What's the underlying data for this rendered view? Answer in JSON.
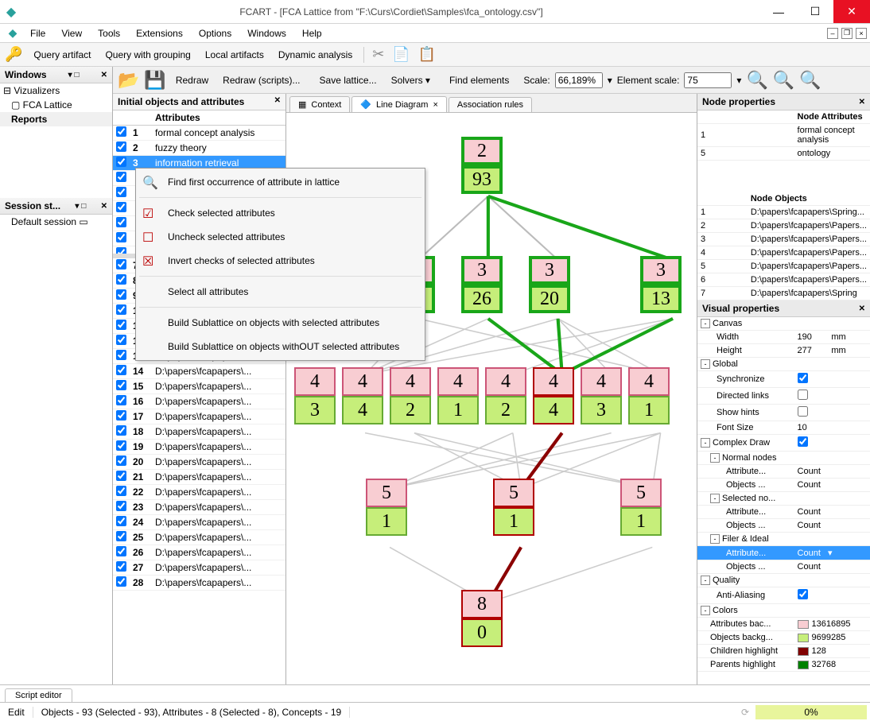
{
  "title": "FCART - [FCA Lattice from \"F:\\Curs\\Cordiet\\Samples\\fca_ontology.csv\"]",
  "menus": [
    "File",
    "View",
    "Tools",
    "Extensions",
    "Options",
    "Windows",
    "Help"
  ],
  "toolbar1": [
    "Query artifact",
    "Query with grouping",
    "Local artifacts",
    "Dynamic analysis"
  ],
  "toolbar2": {
    "redraw": "Redraw",
    "redraw_scripts": "Redraw (scripts)...",
    "save_lattice": "Save lattice...",
    "solvers": "Solvers",
    "find": "Find elements",
    "scale_label": "Scale:",
    "scale_value": "66,189%",
    "elscale_label": "Element scale:",
    "elscale_value": "75"
  },
  "left": {
    "windows_head": "Windows",
    "vizualizers": "Vizualizers",
    "fca_lattice": "FCA Lattice",
    "reports": "Reports",
    "session_head": "Session st...",
    "default_session": "Default session"
  },
  "objattr": {
    "head": "Initial objects and attributes",
    "attr_header": "Attributes",
    "attributes": [
      {
        "n": "1",
        "label": "formal concept analysis",
        "chk": true
      },
      {
        "n": "2",
        "label": "fuzzy theory",
        "chk": true
      },
      {
        "n": "3",
        "label": "information retrieval",
        "chk": true,
        "sel": true
      }
    ],
    "objects": [
      {
        "n": "7",
        "label": "D:\\papers\\fcapapers\\..."
      },
      {
        "n": "8",
        "label": "D:\\papers\\fcapapers\\..."
      },
      {
        "n": "9",
        "label": "D:\\papers\\fcapapers\\..."
      },
      {
        "n": "10",
        "label": "D:\\papers\\fcapapers\\..."
      },
      {
        "n": "11",
        "label": "D:\\papers\\fcapapers\\..."
      },
      {
        "n": "12",
        "label": "D:\\papers\\fcapapers\\..."
      },
      {
        "n": "13",
        "label": "D:\\papers\\fcapapers\\..."
      },
      {
        "n": "14",
        "label": "D:\\papers\\fcapapers\\..."
      },
      {
        "n": "15",
        "label": "D:\\papers\\fcapapers\\..."
      },
      {
        "n": "16",
        "label": "D:\\papers\\fcapapers\\..."
      },
      {
        "n": "17",
        "label": "D:\\papers\\fcapapers\\..."
      },
      {
        "n": "18",
        "label": "D:\\papers\\fcapapers\\..."
      },
      {
        "n": "19",
        "label": "D:\\papers\\fcapapers\\..."
      },
      {
        "n": "20",
        "label": "D:\\papers\\fcapapers\\..."
      },
      {
        "n": "21",
        "label": "D:\\papers\\fcapapers\\..."
      },
      {
        "n": "22",
        "label": "D:\\papers\\fcapapers\\..."
      },
      {
        "n": "23",
        "label": "D:\\papers\\fcapapers\\..."
      },
      {
        "n": "24",
        "label": "D:\\papers\\fcapapers\\..."
      },
      {
        "n": "25",
        "label": "D:\\papers\\fcapapers\\..."
      },
      {
        "n": "26",
        "label": "D:\\papers\\fcapapers\\..."
      },
      {
        "n": "27",
        "label": "D:\\papers\\fcapapers\\..."
      },
      {
        "n": "28",
        "label": "D:\\papers\\fcapapers\\..."
      }
    ]
  },
  "ctx": {
    "find": "Find first occurrence of attribute in lattice",
    "check": "Check selected attributes",
    "uncheck": "Uncheck selected attributes",
    "invert": "Invert checks of selected attributes",
    "selall": "Select all attributes",
    "build_with": "Build Sublattice on objects with selected attributes",
    "build_without": "Build Sublattice on objects withOUT selected attributes"
  },
  "tabs": {
    "context": "Context",
    "line": "Line Diagram",
    "assoc": "Association rules"
  },
  "lattice": {
    "top": {
      "attr": "2",
      "obj": "93"
    },
    "row2": [
      {
        "attr": "3",
        "obj": "6"
      },
      {
        "attr": "3",
        "obj": "26"
      },
      {
        "attr": "3",
        "obj": "20"
      },
      {
        "attr": "3",
        "obj": "13"
      }
    ],
    "row3": [
      {
        "attr": "4",
        "obj": "3"
      },
      {
        "attr": "4",
        "obj": "4"
      },
      {
        "attr": "4",
        "obj": "2"
      },
      {
        "attr": "4",
        "obj": "1"
      },
      {
        "attr": "4",
        "obj": "2"
      },
      {
        "attr": "4",
        "obj": "4",
        "sel": true
      },
      {
        "attr": "4",
        "obj": "3"
      },
      {
        "attr": "4",
        "obj": "1"
      }
    ],
    "row4": [
      {
        "attr": "5",
        "obj": "1"
      },
      {
        "attr": "5",
        "obj": "1",
        "sel": true
      },
      {
        "attr": "5",
        "obj": "1"
      }
    ],
    "bottom": {
      "attr": "8",
      "obj": "0",
      "sel": true
    }
  },
  "node_props": {
    "head": "Node properties",
    "attrs_head": "Node Attributes",
    "attrs": [
      {
        "n": "1",
        "v": "formal concept analysis"
      },
      {
        "n": "5",
        "v": "ontology"
      }
    ],
    "objs_head": "Node Objects",
    "objs": [
      {
        "n": "1",
        "v": "D:\\papers\\fcapapers\\Spring..."
      },
      {
        "n": "2",
        "v": "D:\\papers\\fcapapers\\Papers..."
      },
      {
        "n": "3",
        "v": "D:\\papers\\fcapapers\\Papers..."
      },
      {
        "n": "4",
        "v": "D:\\papers\\fcapapers\\Papers..."
      },
      {
        "n": "5",
        "v": "D:\\papers\\fcapapers\\Papers..."
      },
      {
        "n": "6",
        "v": "D:\\papers\\fcapapers\\Papers..."
      },
      {
        "n": "7",
        "v": "D:\\papers\\fcapapers\\Spring"
      }
    ]
  },
  "visprops": {
    "head": "Visual properties",
    "canvas": "Canvas",
    "width_l": "Width",
    "width_v": "190",
    "mm": "mm",
    "height_l": "Height",
    "height_v": "277",
    "global": "Global",
    "sync": "Synchronize",
    "dir": "Directed links",
    "hint": "Show hints",
    "font_l": "Font Size",
    "font_v": "10",
    "complex": "Complex Draw",
    "normal": "Normal nodes",
    "attr_l": "Attribute...",
    "count": "Count",
    "objs_l": "Objects ...",
    "seln": "Selected no...",
    "filer": "Filer & Ideal",
    "quality": "Quality",
    "aa": "Anti-Aliasing",
    "colors": "Colors",
    "attrbg_l": "Attributes bac...",
    "attrbg_c": "#f8cdd2",
    "attrbg_v": "13616895",
    "objbg_l": "Objects backg...",
    "objbg_c": "#c6ee7a",
    "objbg_v": "9699285",
    "chhl_l": "Children highlight",
    "chhl_c": "#800000",
    "chhl_v": "128",
    "phl_l": "Parents highlight",
    "phl_c": "#008000",
    "phl_v": "32768"
  },
  "bottom": {
    "script": "Script editor",
    "edit": "Edit",
    "status": "Objects - 93 (Selected - 93), Attributes - 8 (Selected - 8), Concepts - 19",
    "pct": "0%"
  }
}
